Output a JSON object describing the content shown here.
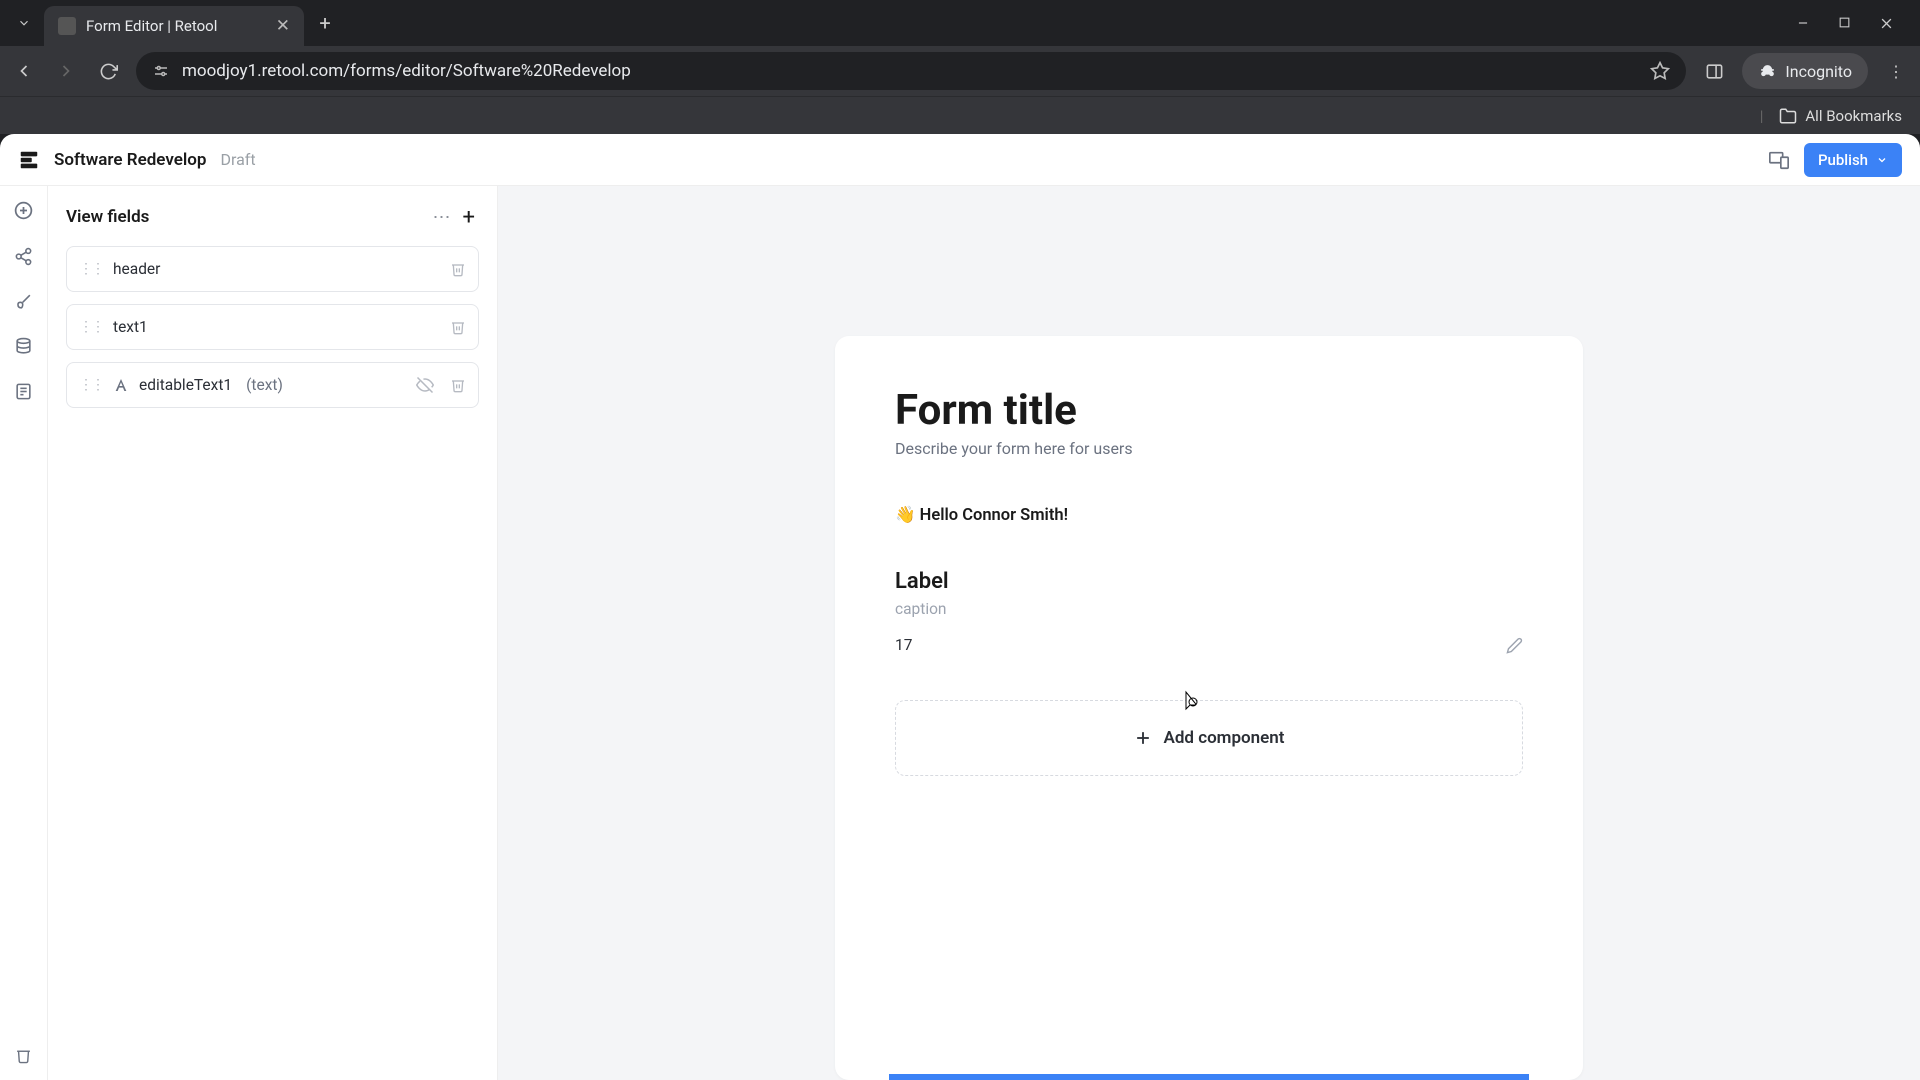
{
  "browser": {
    "tab_title": "Form Editor | Retool",
    "url": "moodjoy1.retool.com/forms/editor/Software%20Redevelop",
    "incognito_label": "Incognito",
    "all_bookmarks": "All Bookmarks"
  },
  "header": {
    "title": "Software Redevelop",
    "status": "Draft",
    "publish": "Publish"
  },
  "panel": {
    "title": "View fields",
    "fields": [
      {
        "name": "header"
      },
      {
        "name": "text1"
      },
      {
        "name": "editableText1",
        "type": "(text)",
        "hidden_toggle": true,
        "icon": "A"
      }
    ]
  },
  "form": {
    "title": "Form title",
    "description": "Describe your form here for users",
    "greeting": "👋 Hello Connor Smith!",
    "label": "Label",
    "caption": "caption",
    "value": "17",
    "add_component": "Add component"
  }
}
